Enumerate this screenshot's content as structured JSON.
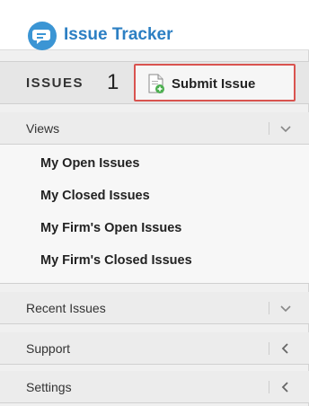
{
  "header": {
    "title": "Issue Tracker",
    "logo_icon": "chat-bubble-icon",
    "brand_color": "#2c7fc3"
  },
  "issues_bar": {
    "label": "ISSUES",
    "step_number": "1",
    "submit_label": "Submit Issue",
    "submit_icon": "new-document-icon",
    "highlight_color": "#d9534f"
  },
  "sections": {
    "views": {
      "label": "Views",
      "state": "expanded",
      "icon": "chevron-down-icon"
    },
    "recent": {
      "label": "Recent Issues",
      "state": "collapsed",
      "icon": "chevron-down-icon"
    },
    "support": {
      "label": "Support",
      "state": "collapsed",
      "icon": "chevron-left-icon"
    },
    "settings": {
      "label": "Settings",
      "state": "collapsed",
      "icon": "chevron-left-icon"
    }
  },
  "views_items": [
    {
      "label": "My Open Issues"
    },
    {
      "label": "My Closed Issues"
    },
    {
      "label": "My Firm's Open Issues"
    },
    {
      "label": "My Firm's Closed Issues"
    }
  ]
}
